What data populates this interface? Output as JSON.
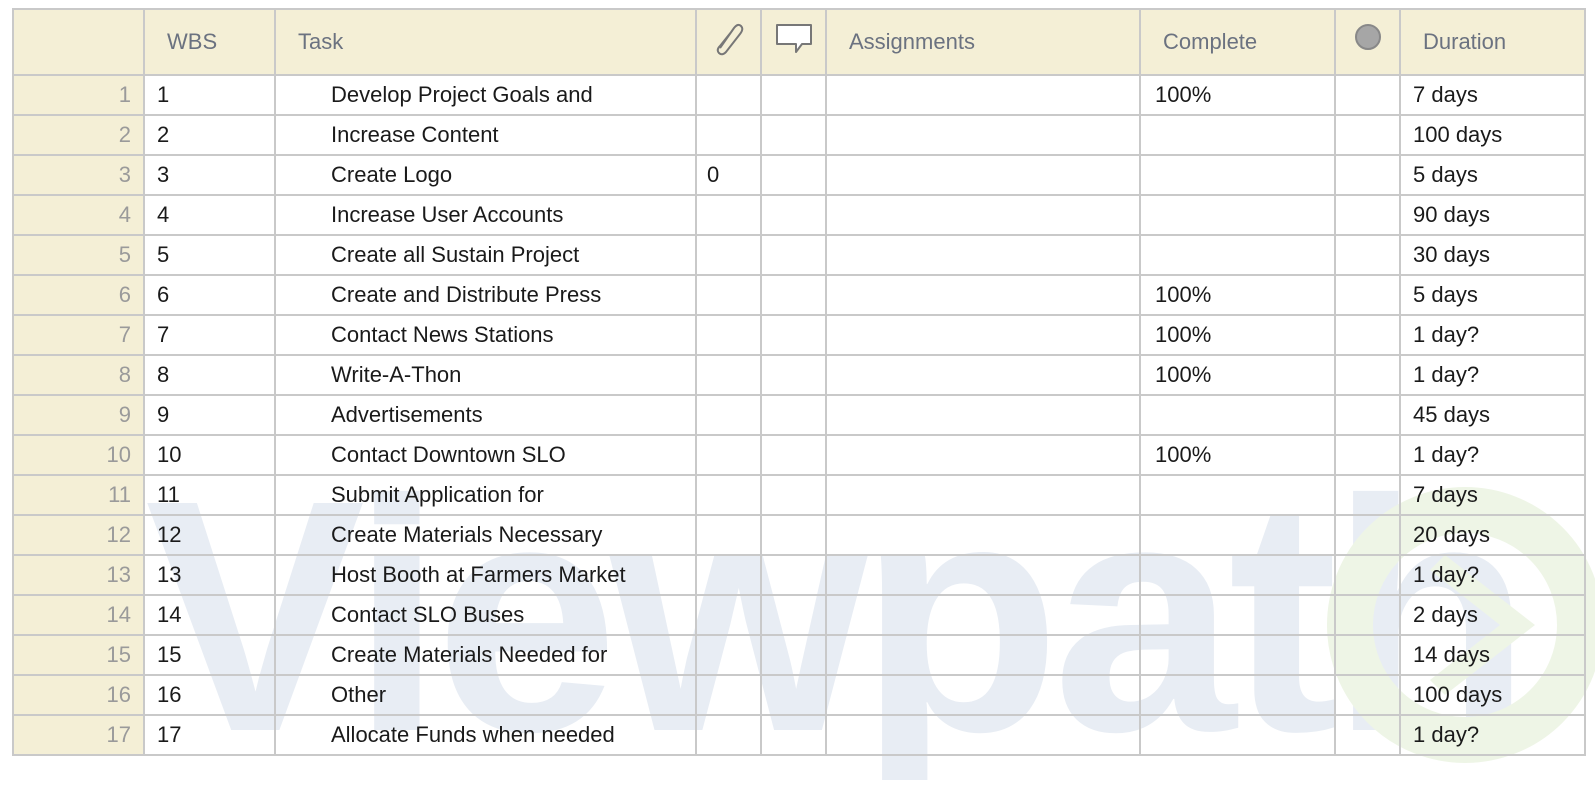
{
  "columns": {
    "wbs": "WBS",
    "task": "Task",
    "attachments_icon": "paperclip-icon",
    "notes_icon": "comment-icon",
    "assignments": "Assignments",
    "complete": "Complete",
    "status_icon": "status-circle-icon",
    "duration": "Duration"
  },
  "rows": [
    {
      "num": "1",
      "wbs": "1",
      "task": "Develop Project Goals and",
      "attach": "",
      "assignments": "",
      "complete": "100%",
      "duration": "7 days"
    },
    {
      "num": "2",
      "wbs": "2",
      "task": "Increase Content",
      "attach": "",
      "assignments": "",
      "complete": "",
      "duration": "100 days"
    },
    {
      "num": "3",
      "wbs": "3",
      "task": "Create Logo",
      "attach": "0",
      "assignments": "",
      "complete": "",
      "duration": "5 days"
    },
    {
      "num": "4",
      "wbs": "4",
      "task": "Increase User Accounts",
      "attach": "",
      "assignments": "",
      "complete": "",
      "duration": "90 days"
    },
    {
      "num": "5",
      "wbs": "5",
      "task": "Create all Sustain Project",
      "attach": "",
      "assignments": "",
      "complete": "",
      "duration": "30 days"
    },
    {
      "num": "6",
      "wbs": "6",
      "task": "Create and Distribute Press",
      "attach": "",
      "assignments": "",
      "complete": "100%",
      "duration": "5 days"
    },
    {
      "num": "7",
      "wbs": "7",
      "task": "Contact News Stations",
      "attach": "",
      "assignments": "",
      "complete": "100%",
      "duration": "1 day?"
    },
    {
      "num": "8",
      "wbs": "8",
      "task": "Write-A-Thon",
      "attach": "",
      "assignments": "",
      "complete": "100%",
      "duration": "1 day?"
    },
    {
      "num": "9",
      "wbs": "9",
      "task": "Advertisements",
      "attach": "",
      "assignments": "",
      "complete": "",
      "duration": "45 days"
    },
    {
      "num": "10",
      "wbs": "10",
      "task": "Contact Downtown SLO",
      "attach": "",
      "assignments": "",
      "complete": "100%",
      "duration": "1 day?"
    },
    {
      "num": "11",
      "wbs": "11",
      "task": "Submit Application for",
      "attach": "",
      "assignments": "",
      "complete": "",
      "duration": "7 days"
    },
    {
      "num": "12",
      "wbs": "12",
      "task": "Create Materials Necessary",
      "attach": "",
      "assignments": "",
      "complete": "",
      "duration": "20 days"
    },
    {
      "num": "13",
      "wbs": "13",
      "task": "Host Booth at Farmers Market",
      "attach": "",
      "assignments": "",
      "complete": "",
      "duration": "1 day?"
    },
    {
      "num": "14",
      "wbs": "14",
      "task": "Contact SLO Buses",
      "attach": "",
      "assignments": "",
      "complete": "",
      "duration": "2 days"
    },
    {
      "num": "15",
      "wbs": "15",
      "task": "Create Materials Needed for",
      "attach": "",
      "assignments": "",
      "complete": "",
      "duration": "14 days"
    },
    {
      "num": "16",
      "wbs": "16",
      "task": "Other",
      "attach": "",
      "assignments": "",
      "complete": "",
      "duration": "100 days"
    },
    {
      "num": "17",
      "wbs": "17",
      "task": "Allocate Funds when needed",
      "attach": "",
      "assignments": "",
      "complete": "",
      "duration": "1 day?"
    }
  ],
  "watermark": {
    "text": "Viewpath",
    "color": "#e8edf4",
    "accent_color": "#eef5e6"
  },
  "colors": {
    "header_bg": "#f4efd6",
    "grid": "#c9c9c9",
    "row_number": "#9a9a9a"
  }
}
